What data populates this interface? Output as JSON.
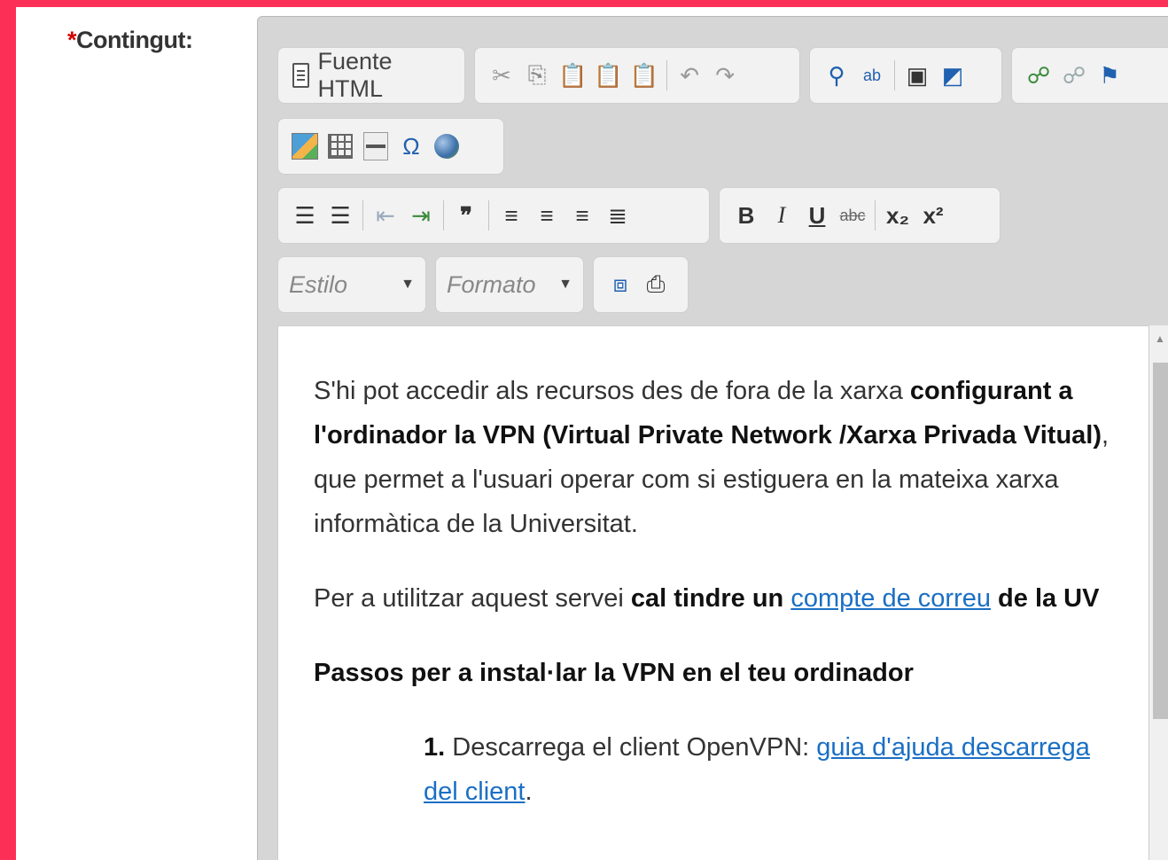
{
  "field": {
    "required_mark": "*",
    "label": "Contingut:"
  },
  "toolbar": {
    "source_label": "Fuente HTML",
    "style_placeholder": "Estilo",
    "format_placeholder": "Formato",
    "bold": "B",
    "italic": "I",
    "underline": "U",
    "strike": "abc",
    "subscript": "x₂",
    "superscript": "x²",
    "blockquote": "❞",
    "special_char": "Ω"
  },
  "content": {
    "p1": {
      "a": "S'hi pot accedir als recursos des de fora de la xarxa ",
      "b": "configurant a l'ordinador la VPN (Virtual Private Network /Xarxa Privada Vitual)",
      "c": ", que permet a l'usuari operar com si estiguera en la mateixa xarxa informàtica de la Universitat."
    },
    "p2": {
      "a": "Per a utilitzar aquest servei ",
      "b": "cal tindre un ",
      "link": "compte de correu",
      "c": " de la UV"
    },
    "p3": "Passos per a instal·lar la VPN en el teu ordinador",
    "li1": {
      "num": "1.",
      "a": " Descarrega el client OpenVPN: ",
      "link": "guia d'ajuda descarrega del client",
      "end": "."
    }
  }
}
